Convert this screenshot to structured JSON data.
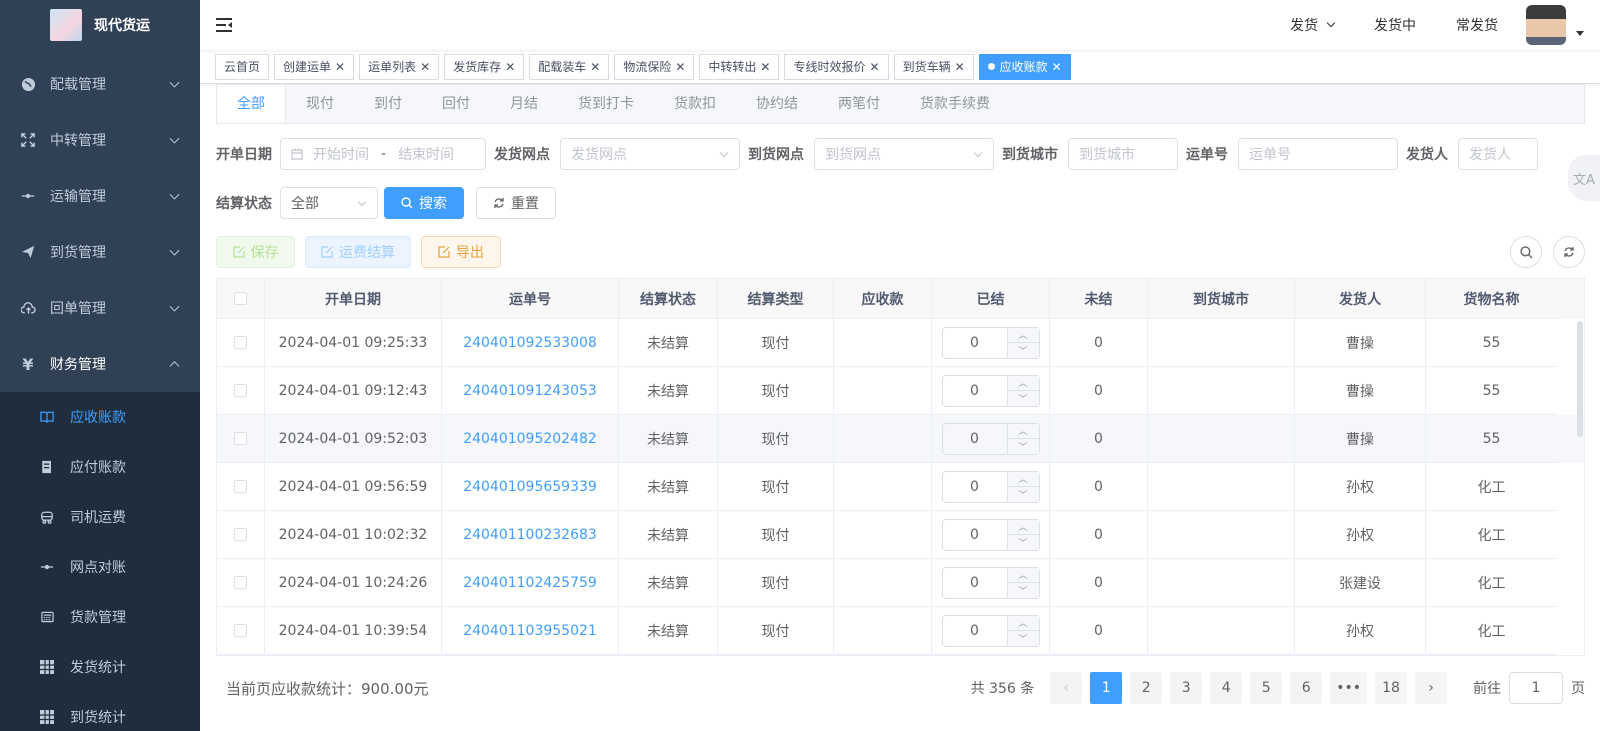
{
  "app": {
    "title": "现代货运"
  },
  "sidebar": {
    "menus": [
      {
        "label": "配载管理",
        "icon": "globe-icon"
      },
      {
        "label": "中转管理",
        "icon": "fullscreen-icon"
      },
      {
        "label": "运输管理",
        "icon": "commit-icon"
      },
      {
        "label": "到货管理",
        "icon": "send-icon"
      },
      {
        "label": "回单管理",
        "icon": "upload-cloud-icon"
      },
      {
        "label": "财务管理",
        "icon": "yen-icon"
      }
    ],
    "sub_items": [
      {
        "label": "应收账款",
        "icon": "book-icon"
      },
      {
        "label": "应付账款",
        "icon": "document-icon"
      },
      {
        "label": "司机运费",
        "icon": "bus-icon"
      },
      {
        "label": "网点对账",
        "icon": "commit-icon"
      },
      {
        "label": "货款管理",
        "icon": "calculator-icon"
      },
      {
        "label": "发货统计",
        "icon": "grid-icon"
      },
      {
        "label": "到货统计",
        "icon": "grid-icon"
      }
    ]
  },
  "navbar": {
    "links": [
      "发货",
      "发货中",
      "常发货"
    ]
  },
  "tags": [
    {
      "label": "云首页"
    },
    {
      "label": "创建运单"
    },
    {
      "label": "运单列表"
    },
    {
      "label": "发货库存"
    },
    {
      "label": "配载装车"
    },
    {
      "label": "物流保险"
    },
    {
      "label": "中转转出"
    },
    {
      "label": "专线时效报价"
    },
    {
      "label": "到货车辆"
    },
    {
      "label": "应收账款"
    }
  ],
  "tabs": [
    "全部",
    "现付",
    "到付",
    "回付",
    "月结",
    "货到打卡",
    "货款扣",
    "协约结",
    "两笔付",
    "货款手续费"
  ],
  "filters": {
    "date_label": "开单日期",
    "date_start": "开始时间",
    "date_sep": "-",
    "date_end": "结束时间",
    "ship_point_label": "发货网点",
    "ship_point_ph": "发货网点",
    "arrive_point_label": "到货网点",
    "arrive_point_ph": "到货网点",
    "arrive_city_label": "到货城市",
    "arrive_city_ph": "到货城市",
    "waybill_label": "运单号",
    "waybill_ph": "运单号",
    "shipper_label": "发货人",
    "shipper_ph": "发货人",
    "settle_label": "结算状态",
    "settle_value": "全部",
    "search": "搜索",
    "reset": "重置"
  },
  "toolbar": {
    "save": "保存",
    "settle": "运费结算",
    "export": "导出"
  },
  "table": {
    "headers": [
      "开单日期",
      "运单号",
      "结算状态",
      "结算类型",
      "应收款",
      "已结",
      "未结",
      "到货城市",
      "发货人",
      "货物名称"
    ],
    "rows": [
      {
        "date": "2024-04-01 09:25:33",
        "no": "240401092533008",
        "status": "未结算",
        "type": "现付",
        "recv": "",
        "paid": "0",
        "unpaid": "0",
        "city": "",
        "shipper": "曹操",
        "goods": "55"
      },
      {
        "date": "2024-04-01 09:12:43",
        "no": "240401091243053",
        "status": "未结算",
        "type": "现付",
        "recv": "",
        "paid": "0",
        "unpaid": "0",
        "city": "",
        "shipper": "曹操",
        "goods": "55"
      },
      {
        "date": "2024-04-01 09:52:03",
        "no": "240401095202482",
        "status": "未结算",
        "type": "现付",
        "recv": "",
        "paid": "0",
        "unpaid": "0",
        "city": "",
        "shipper": "曹操",
        "goods": "55"
      },
      {
        "date": "2024-04-01 09:56:59",
        "no": "240401095659339",
        "status": "未结算",
        "type": "现付",
        "recv": "",
        "paid": "0",
        "unpaid": "0",
        "city": "",
        "shipper": "孙权",
        "goods": "化工"
      },
      {
        "date": "2024-04-01 10:02:32",
        "no": "240401100232683",
        "status": "未结算",
        "type": "现付",
        "recv": "",
        "paid": "0",
        "unpaid": "0",
        "city": "",
        "shipper": "孙权",
        "goods": "化工"
      },
      {
        "date": "2024-04-01 10:24:26",
        "no": "240401102425759",
        "status": "未结算",
        "type": "现付",
        "recv": "",
        "paid": "0",
        "unpaid": "0",
        "city": "",
        "shipper": "张建设",
        "goods": "化工"
      },
      {
        "date": "2024-04-01 10:39:54",
        "no": "240401103955021",
        "status": "未结算",
        "type": "现付",
        "recv": "",
        "paid": "0",
        "unpaid": "0",
        "city": "",
        "shipper": "孙权",
        "goods": "化工"
      }
    ]
  },
  "footer": {
    "summary": "当前页应收款统计：900.00元",
    "total": "共 356 条",
    "pages": [
      "1",
      "2",
      "3",
      "4",
      "5",
      "6",
      "•••",
      "18"
    ],
    "goto_label": "前往",
    "goto_value": "1",
    "page_unit": "页"
  },
  "colors": {
    "primary": "#409eff",
    "sidebar": "#304156",
    "submenu": "#1f2d3d"
  }
}
